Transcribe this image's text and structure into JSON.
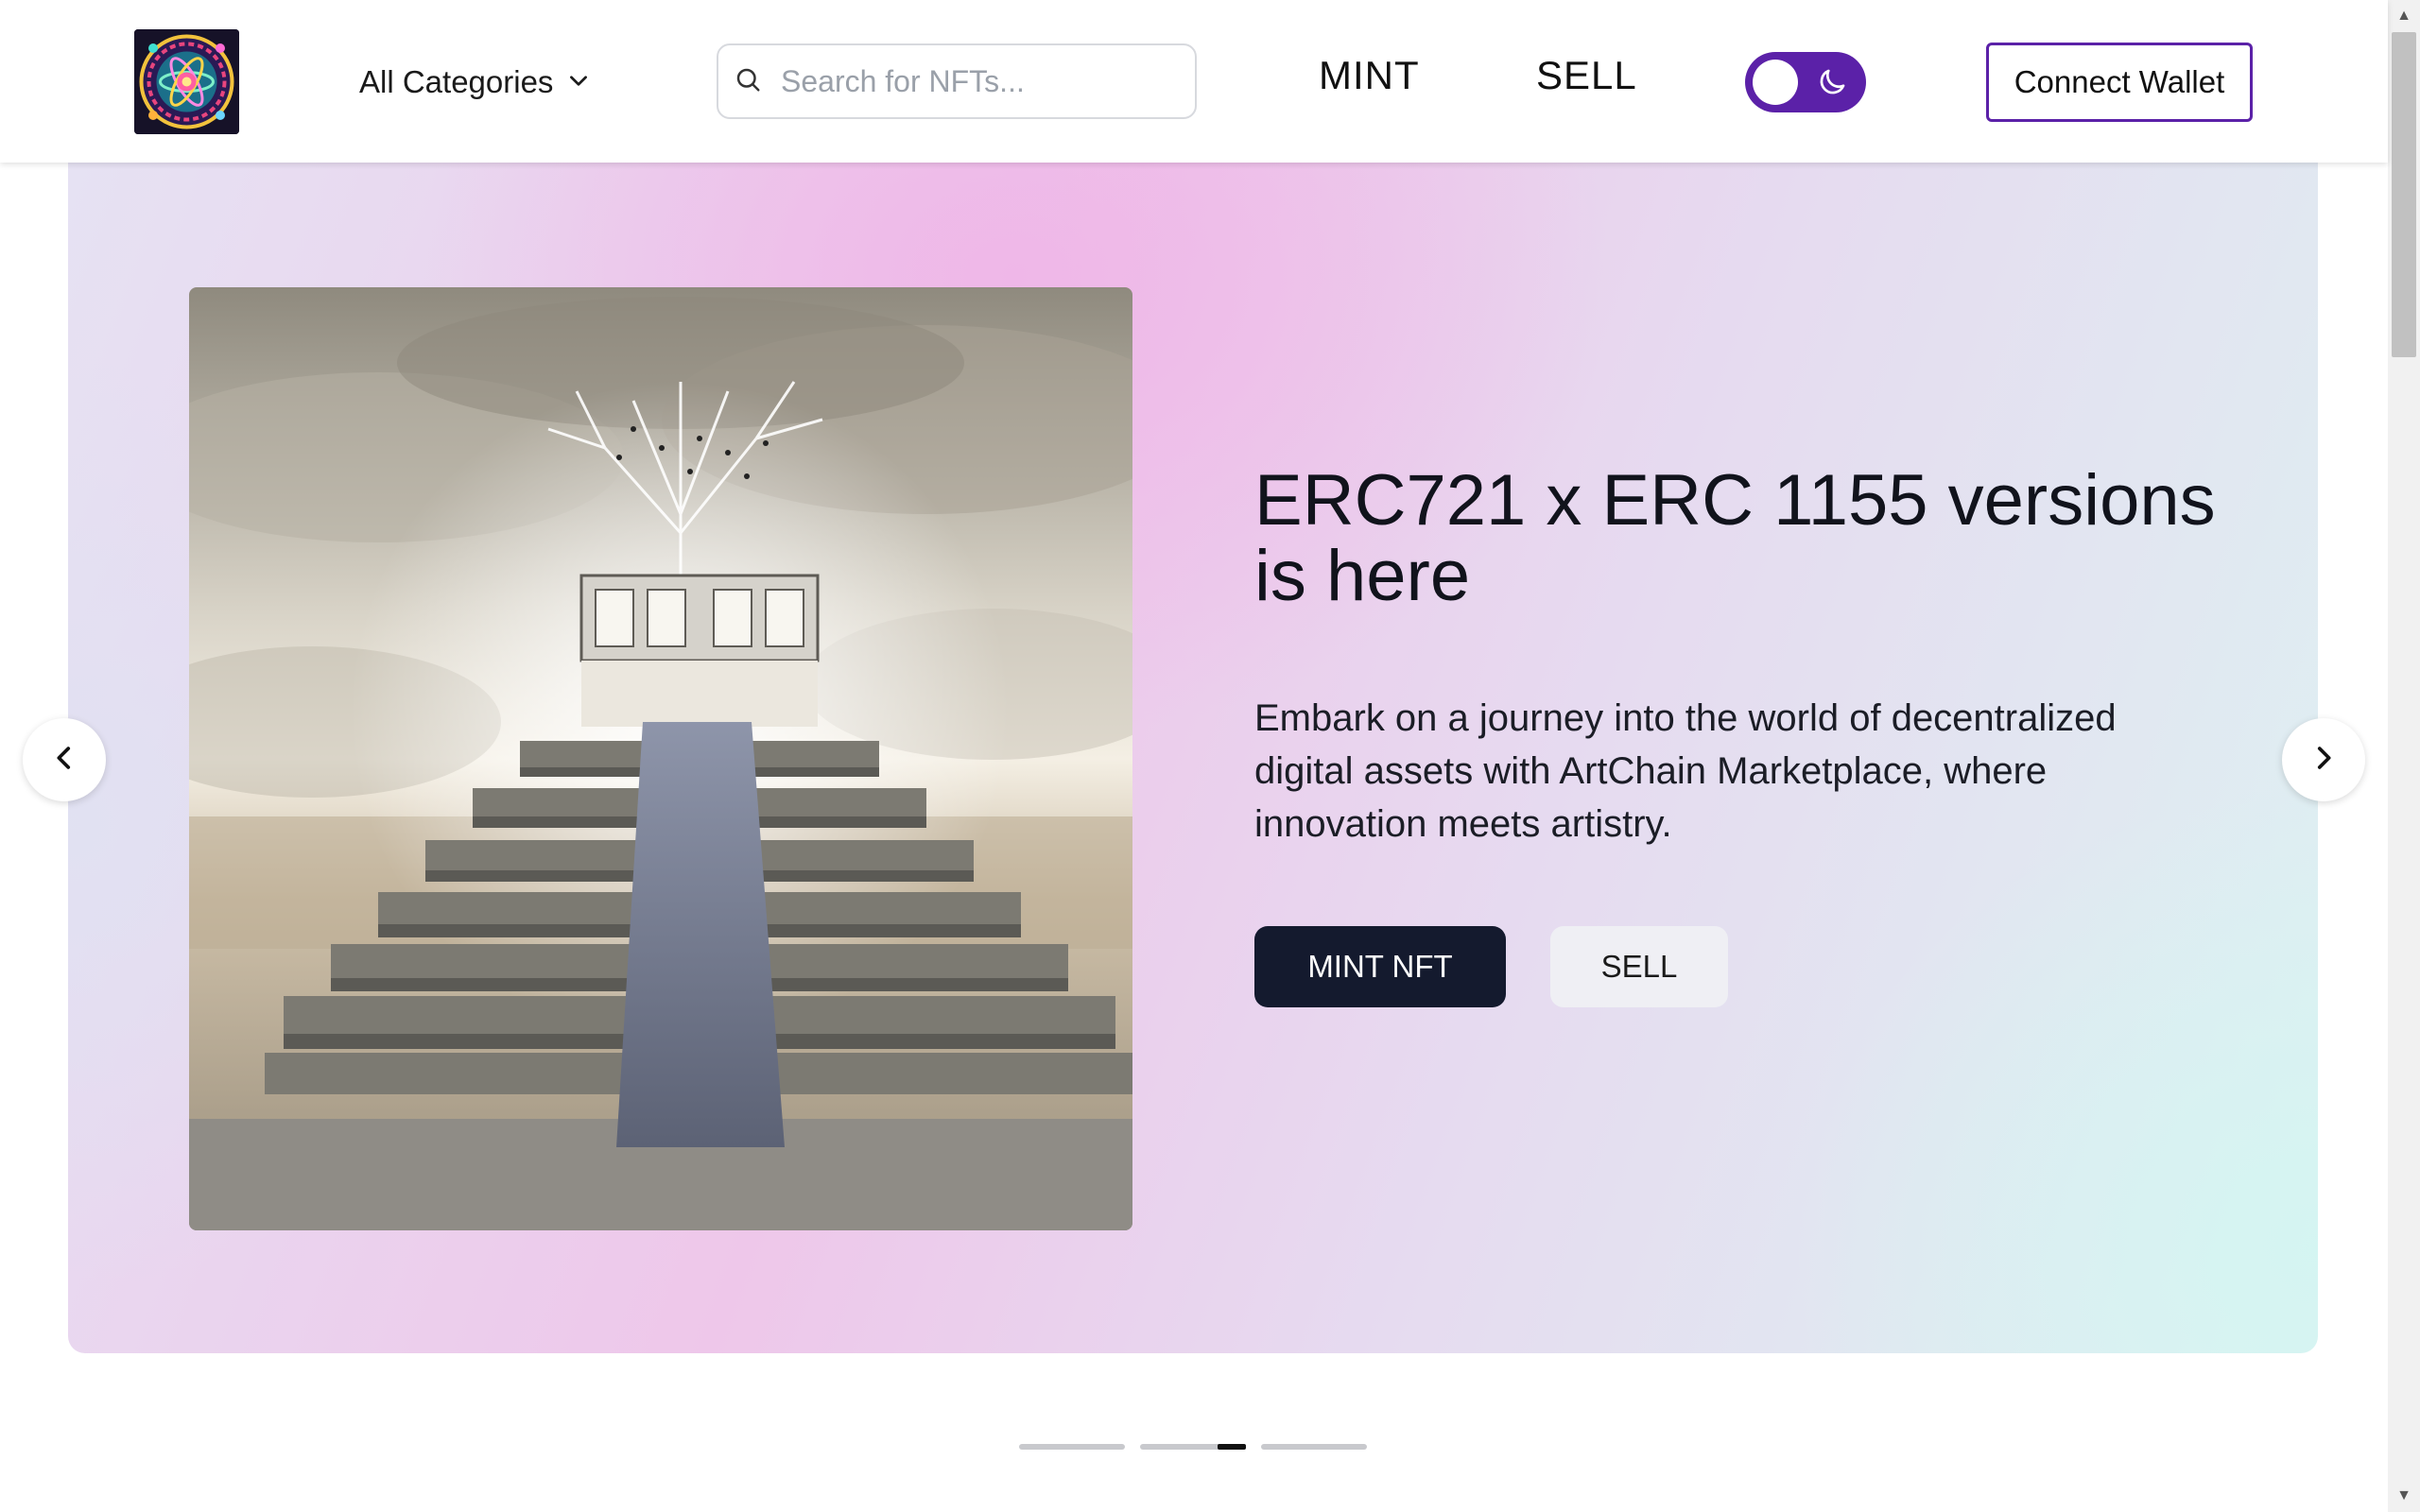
{
  "header": {
    "logo_alt": "ArtChain logo",
    "categories_label": "All Categories",
    "search_placeholder": "Search for NFTs...",
    "nav": {
      "mint": "MINT",
      "sell": "SELL"
    },
    "theme_toggle": {
      "state": "light",
      "icon": "moon-icon",
      "accent": "#5b21a8"
    },
    "connect_wallet": "Connect Wallet"
  },
  "hero": {
    "title": "ERC721 x ERC 1155 versions is here",
    "description": "Embark on a journey into the world of decentralized digital assets with ArtChain Marketplace, where innovation meets artistry.",
    "primary_button": "MINT NFT",
    "secondary_button": "SELL",
    "prev_icon": "chevron-left-icon",
    "next_icon": "chevron-right-icon"
  },
  "carousel": {
    "slide_count": 3,
    "active_index": 1
  },
  "colors": {
    "accent": "#5b21a8",
    "primary_button": "#141a2e",
    "secondary_button": "#efeff4"
  }
}
